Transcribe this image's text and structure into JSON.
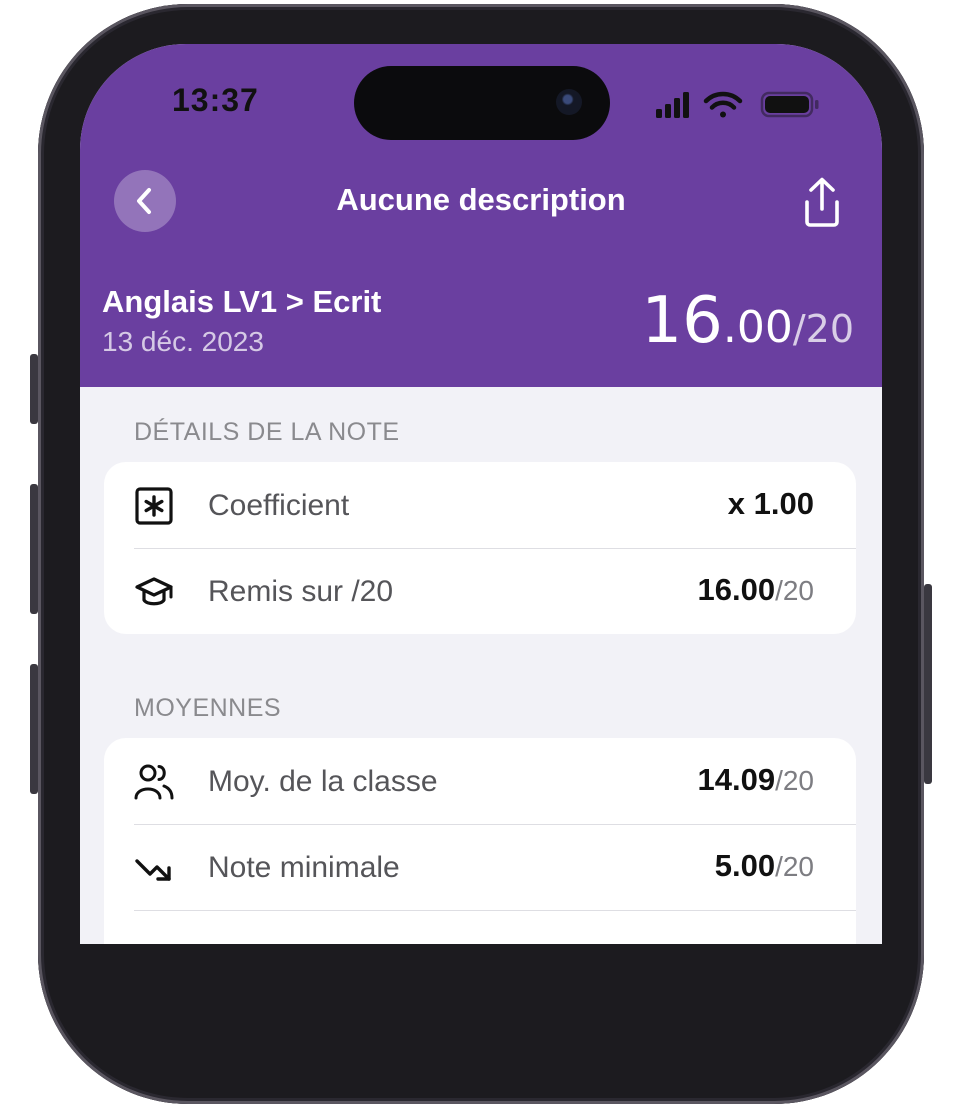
{
  "status_bar": {
    "time": "13:37"
  },
  "header": {
    "title": "Aucune description",
    "subject": "Anglais LV1 > Ecrit",
    "date": "13 déc. 2023",
    "grade": {
      "integer": "16",
      "decimal": ".00",
      "denominator": "/20"
    }
  },
  "sections": {
    "details": {
      "label": "DÉTAILS DE LA NOTE",
      "rows": [
        {
          "icon": "asterisk-box-icon",
          "label": "Coefficient",
          "value": "x 1.00",
          "suffix": ""
        },
        {
          "icon": "graduation-cap-icon",
          "label": "Remis sur /20",
          "value": "16.00",
          "suffix": "/20"
        }
      ]
    },
    "averages": {
      "label": "MOYENNES",
      "rows": [
        {
          "icon": "users-icon",
          "label": "Moy. de la classe",
          "value": "14.09",
          "suffix": "/20"
        },
        {
          "icon": "trend-down-icon",
          "label": "Note minimale",
          "value": "5.00",
          "suffix": "/20"
        }
      ]
    }
  },
  "colors": {
    "header": "#6a3fa0",
    "background": "#f2f2f7"
  }
}
